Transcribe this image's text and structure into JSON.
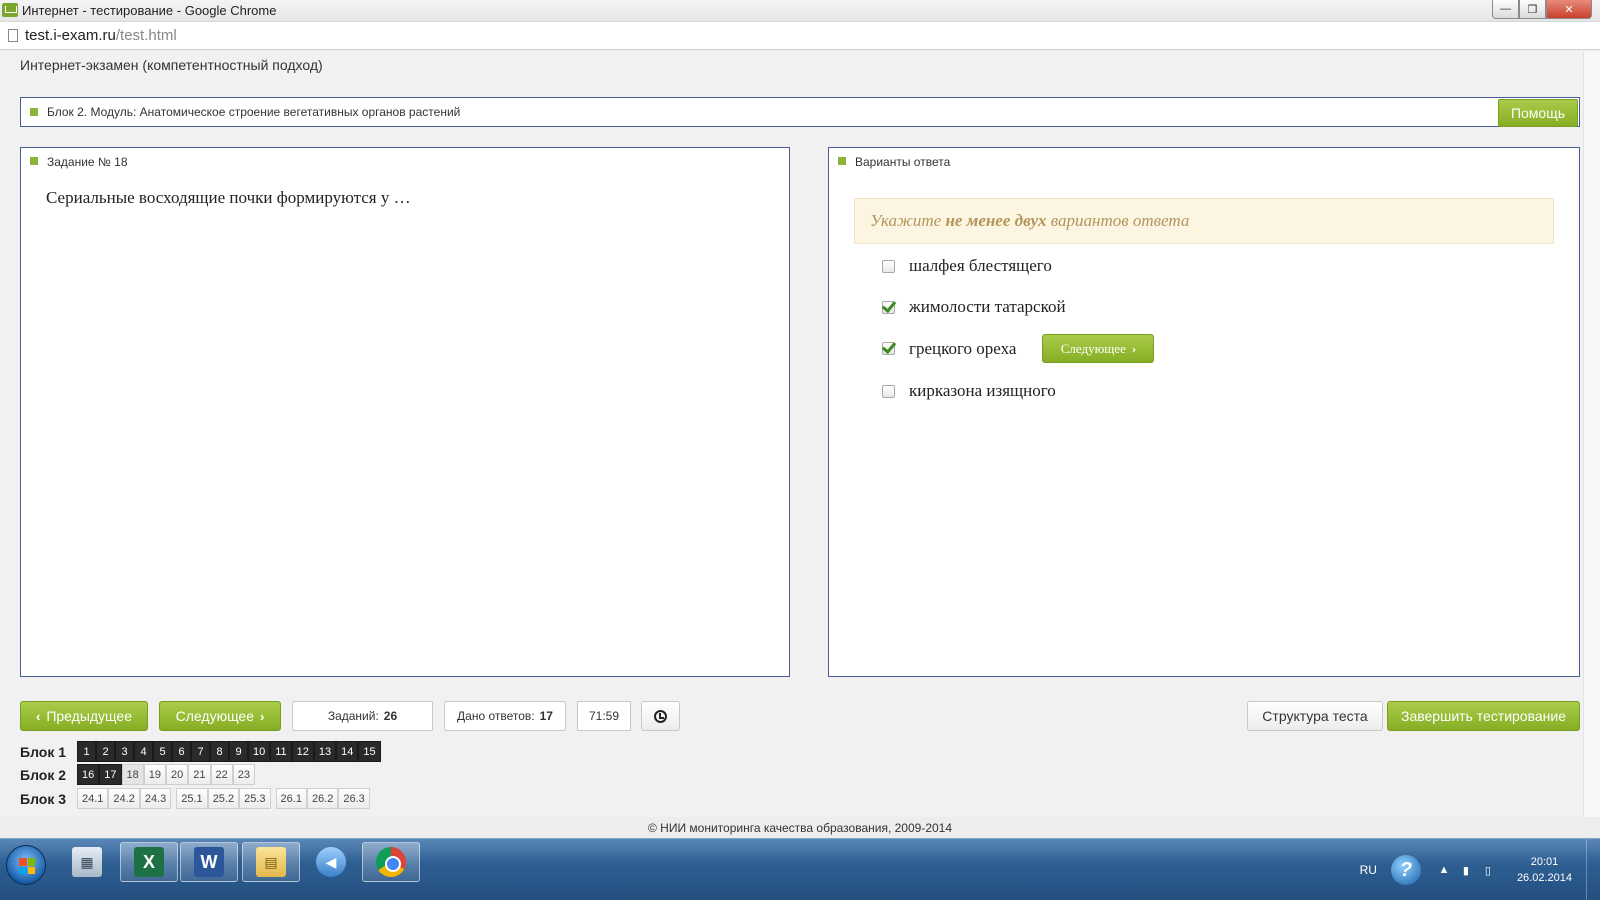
{
  "window": {
    "title": "Интернет - тестирование - Google Chrome",
    "minimize_glyph": "—",
    "maximize_glyph": "❐",
    "close_glyph": "✕"
  },
  "address_bar": {
    "host": "test.i-exam.ru",
    "path": "/test.html"
  },
  "page": {
    "header": "Интернет-экзамен (компетентностный подход)",
    "block_title": "Блок 2. Модуль: Анатомическое строение вегетативных органов растений",
    "help_button": "Помощь"
  },
  "task": {
    "label": "Задание № 18",
    "question": "Сериальные восходящие почки формируются у …"
  },
  "answers": {
    "label": "Варианты ответа",
    "hint_prefix": "Укажите",
    "hint_bold": "не менее двух",
    "hint_suffix": "вариантов ответа",
    "options": [
      {
        "text": "шалфея блестящего",
        "checked": false
      },
      {
        "text": "жимолости татарской",
        "checked": true
      },
      {
        "text": "грецкого ореха",
        "checked": true
      },
      {
        "text": "кирказона изящного",
        "checked": false
      }
    ],
    "next_inline": "Следующее"
  },
  "controls": {
    "prev_button": "Предыдущее",
    "next_button": "Следующее",
    "tasks_label": "Заданий:",
    "tasks_count": "26",
    "answered_label": "Дано ответов:",
    "answered_count": "17",
    "timer": "71:59",
    "structure_button": "Структура теста",
    "finish_button": "Завершить тестирование"
  },
  "blocks": [
    {
      "label": "Блок 1",
      "groups": [
        [
          {
            "n": "1",
            "state": "done"
          },
          {
            "n": "2",
            "state": "done"
          },
          {
            "n": "3",
            "state": "done"
          },
          {
            "n": "4",
            "state": "done"
          },
          {
            "n": "5",
            "state": "done"
          },
          {
            "n": "6",
            "state": "done"
          },
          {
            "n": "7",
            "state": "done"
          },
          {
            "n": "8",
            "state": "done"
          },
          {
            "n": "9",
            "state": "done"
          },
          {
            "n": "10",
            "state": "done"
          },
          {
            "n": "11",
            "state": "done"
          },
          {
            "n": "12",
            "state": "done"
          },
          {
            "n": "13",
            "state": "done"
          },
          {
            "n": "14",
            "state": "done"
          },
          {
            "n": "15",
            "state": "done"
          }
        ]
      ]
    },
    {
      "label": "Блок 2",
      "groups": [
        [
          {
            "n": "16",
            "state": "done"
          },
          {
            "n": "17",
            "state": "done"
          },
          {
            "n": "18",
            "state": "current"
          },
          {
            "n": "19",
            "state": "todo"
          },
          {
            "n": "20",
            "state": "todo"
          },
          {
            "n": "21",
            "state": "todo"
          },
          {
            "n": "22",
            "state": "todo"
          },
          {
            "n": "23",
            "state": "todo"
          }
        ]
      ]
    },
    {
      "label": "Блок 3",
      "groups": [
        [
          {
            "n": "24.1",
            "state": "todo"
          },
          {
            "n": "24.2",
            "state": "todo"
          },
          {
            "n": "24.3",
            "state": "todo"
          }
        ],
        [
          {
            "n": "25.1",
            "state": "todo"
          },
          {
            "n": "25.2",
            "state": "todo"
          },
          {
            "n": "25.3",
            "state": "todo"
          }
        ],
        [
          {
            "n": "26.1",
            "state": "todo"
          },
          {
            "n": "26.2",
            "state": "todo"
          },
          {
            "n": "26.3",
            "state": "todo"
          }
        ]
      ]
    }
  ],
  "footer": "© НИИ мониторинга качества образования, 2009-2014",
  "taskbar": {
    "apps": [
      {
        "name": "calculator-icon",
        "glyph": "▦",
        "cls": "calc",
        "active": false
      },
      {
        "name": "excel-icon",
        "glyph": "X",
        "cls": "excel",
        "active": true
      },
      {
        "name": "word-icon",
        "glyph": "W",
        "cls": "word",
        "active": true
      },
      {
        "name": "folder-icon",
        "glyph": "▤",
        "cls": "folder",
        "active": true
      },
      {
        "name": "media-icon",
        "glyph": "◀",
        "cls": "media",
        "active": false
      },
      {
        "name": "chrome-icon",
        "glyph": "",
        "cls": "chrome",
        "active": true
      }
    ],
    "lang": "RU",
    "help_glyph": "?",
    "tray_glyphs": [
      "▲",
      "▮",
      "▯"
    ],
    "time": "20:01",
    "date": "26.02.2014"
  },
  "colors": {
    "accent_green": "#8cb53a",
    "panel_border": "#4a5a9a",
    "done_cell": "#2a2a2a",
    "hint_bg": "#fcf5e1"
  }
}
